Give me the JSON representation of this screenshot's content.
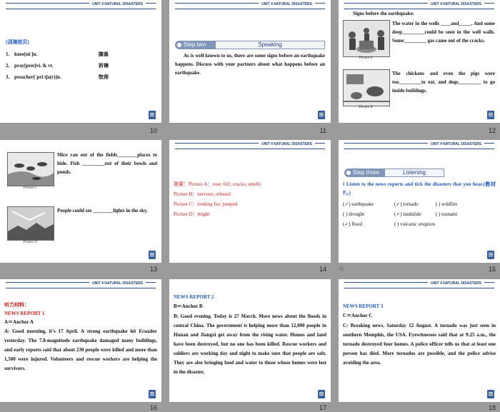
{
  "common": {
    "unit_tag": "UNIT 4 NATURAL DISASTERS"
  },
  "s10": {
    "page": "10",
    "heading": "[词海拾贝]",
    "items": [
      {
        "num": "1.",
        "term": "knee[niː]n.",
        "meaning": "膝盖"
      },
      {
        "num": "2.",
        "term": "pray[preɪ]vi. & vt.",
        "meaning": "祈祷"
      },
      {
        "num": "3.",
        "term": "preacher[ˈpriːtʃə(r)]n.",
        "meaning": "牧师"
      }
    ]
  },
  "s11": {
    "page": "11",
    "banner_step": "Step two",
    "banner_title": "Speaking",
    "text": "As is well known to us, there are some signs before an earthquake happens. Discuss with your partners about what happens before an earthquake."
  },
  "s12": {
    "page": "12",
    "title": "Signs before the earthquake:",
    "para_a": "The water in the wells ____and_____. And some deep_________could be seen in the well walls. Some_________ gas came out of the cracks.",
    "para_b": "The chickens and even the pigs were too_________to eat, and dogs_________ to go inside buildings.",
    "cap_a": "Picture A",
    "cap_b": "Picture B"
  },
  "s13": {
    "page": "13",
    "para_c": "Mice ran out of the fields________places to hide. Fish _________out of their bowls and ponds.",
    "para_d": "People could see ________lights in the sky.",
    "cap_c": "Picture C",
    "cap_d": "Picture D"
  },
  "s14": {
    "page": "14",
    "lines": [
      "答案：Picture A：rose; fell; cracks; smelly",
      "Picture B：nervous; refused",
      "Picture C：looking for; jumped",
      "Picture D：bright"
    ]
  },
  "s15": {
    "page": "15",
    "banner_step": "Step three",
    "banner_title": "Listening",
    "instruction": "Ⅰ Listen to the news reports and tick the disasters that you hear.(教材 P₆₂)",
    "options": [
      [
        "(✓) earthquake",
        "(✓) tornado",
        "(   ) wildfire"
      ],
      [
        "(   ) drought",
        "(✓) landslide",
        "(   ) tsunami"
      ],
      [
        "(✓) flood",
        "(   ) volcanic eruption",
        ""
      ]
    ],
    "star": "☆"
  },
  "s16": {
    "page": "16",
    "label": "听力材料：",
    "report": "NEWS REPORT 1",
    "anchor": "A＝Anchor A",
    "body": "A: Good morning, it’s 17 April. A strong earthquake hit Ecuador yesterday. The 7.8-magnitude earthquake damaged many buildings, and early reports said that about 230 people were killed and more than 1,500 were injured. Volunteers and rescue workers are helping the survivors."
  },
  "s17": {
    "page": "17",
    "report": "NEWS REPORT 2",
    "anchor": "B＝Anchor B",
    "body": "B: Good evening. Today is 27 March. More news about the floods in central China. The government is helping more than 12,000 people in Hunan and Jiangxi get away from the rising water. Homes and land have been destroyed, but no one has been killed. Rescue workers and soldiers are working day and night to make sure that people are safe. They are also bringing food and water to those whose homes were lost in the disaster."
  },
  "s18": {
    "page": "18",
    "report": "NEWS REPORT 3",
    "anchor": "C＝Anchor C",
    "body": "C: Breaking news, Saturday 12 August. A tornado was just seen in southern Memphis, the USA. Eyewitnesses said that at 9:25 a.m., the tornado destroyed four homes. A police officer tells us that at least one person has died. More tornados are possible, and the police advise avoiding the area."
  }
}
